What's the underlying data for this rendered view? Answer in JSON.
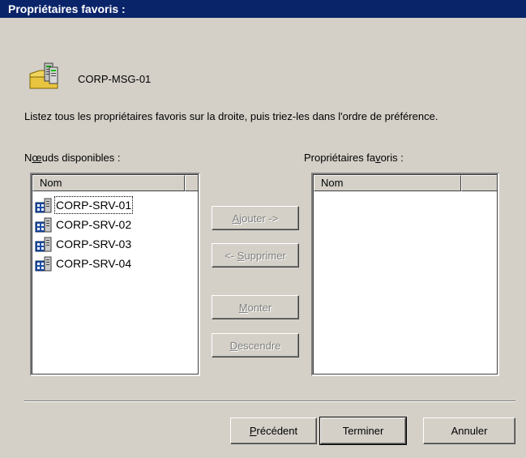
{
  "window": {
    "title": "Propriétaires favoris :"
  },
  "header": {
    "server_name": "CORP-MSG-01",
    "server_icon": "server-folder-icon"
  },
  "instruction": "Listez tous les propriétaires favoris sur la droite, puis triez-les dans l'ordre de préférence.",
  "available_nodes": {
    "label_prefix": "N",
    "label_mnemonic": "œ",
    "label_rest": "uds disponibles :",
    "column_header": "Nom",
    "items": [
      {
        "name": "CORP-SRV-01",
        "icon": "cluster-node-icon",
        "focused": true
      },
      {
        "name": "CORP-SRV-02",
        "icon": "cluster-node-icon",
        "focused": false
      },
      {
        "name": "CORP-SRV-03",
        "icon": "cluster-node-icon",
        "focused": false
      },
      {
        "name": "CORP-SRV-04",
        "icon": "cluster-node-icon",
        "focused": false
      }
    ]
  },
  "preferred_owners": {
    "label_prefix": "Propriétaires fa",
    "label_mnemonic": "v",
    "label_rest": "oris :",
    "column_header": "Nom",
    "items": []
  },
  "buttons": {
    "add": {
      "prefix": "",
      "mnemonic": "A",
      "rest": "jouter ->",
      "enabled": false
    },
    "remove": {
      "prefix": "<- ",
      "mnemonic": "S",
      "rest": "upprimer",
      "enabled": false
    },
    "up": {
      "prefix": "",
      "mnemonic": "M",
      "rest": "onter",
      "enabled": false
    },
    "down": {
      "prefix": "",
      "mnemonic": "D",
      "rest": "escendre",
      "enabled": false
    }
  },
  "footer": {
    "previous": {
      "prefix": "",
      "mnemonic": "P",
      "rest": "récédent"
    },
    "finish": {
      "label": "Terminer"
    },
    "cancel": {
      "label": "Annuler"
    }
  },
  "colors": {
    "titlebar": "#0a246a",
    "face": "#d4d0c8",
    "disabled_text": "#808080"
  }
}
